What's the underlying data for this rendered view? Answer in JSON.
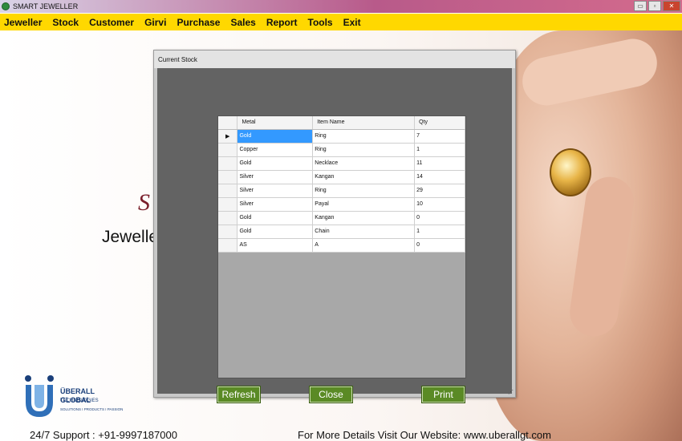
{
  "app": {
    "title": "SMART JEWELLER",
    "window_buttons": [
      "▭",
      "▫",
      "✕"
    ]
  },
  "menu": [
    "Jeweller",
    "Stock",
    "Customer",
    "Girvi",
    "Purchase",
    "Sales",
    "Report",
    "Tools",
    "Exit"
  ],
  "background": {
    "brand_script": "S",
    "brand_text": "Jewelle",
    "logo_name": "ÜBERALL GLOBAL",
    "logo_sub": "TECHNOLOGIES",
    "logo_tag": "SOLUTIONS I PRODUCTS I PASSION",
    "support": "24/7 Support : +91-9997187000",
    "website": "For More Details Visit Our Website: www.uberallgt.com"
  },
  "dialog": {
    "title": "Current Stock",
    "columns": [
      "Metal",
      "Item Name",
      "Qty"
    ],
    "current_row_marker": "▶",
    "rows": [
      [
        "Gold",
        "Ring",
        "7"
      ],
      [
        "Copper",
        "Ring",
        "1"
      ],
      [
        "Gold",
        "Necklace",
        "11"
      ],
      [
        "Silver",
        "Kangan",
        "14"
      ],
      [
        "Silver",
        "Ring",
        "29"
      ],
      [
        "Silver",
        "Payal",
        "10"
      ],
      [
        "Gold",
        "Kangan",
        "0"
      ],
      [
        "Gold",
        "Chain",
        "1"
      ],
      [
        "AS",
        "A",
        "0"
      ]
    ],
    "buttons": {
      "refresh": "Refresh",
      "close": "Close",
      "print": "Print"
    }
  }
}
